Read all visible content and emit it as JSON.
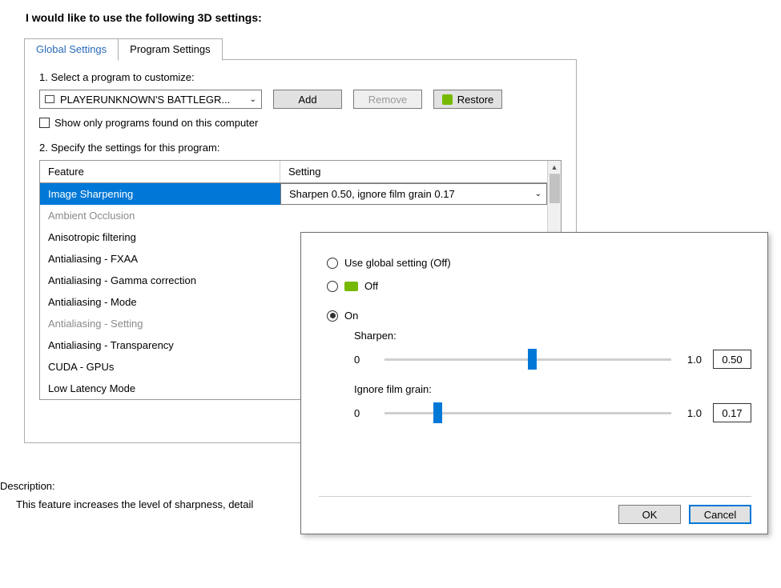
{
  "title": "I would like to use the following 3D settings:",
  "tabs": {
    "global": "Global Settings",
    "program": "Program Settings"
  },
  "step1": "1. Select a program to customize:",
  "selected_program": "PLAYERUNKNOWN'S BATTLEGR...",
  "buttons": {
    "add": "Add",
    "remove": "Remove",
    "restore": "Restore"
  },
  "show_only": "Show only programs found on this computer",
  "step2": "2. Specify the settings for this program:",
  "grid": {
    "feature_header": "Feature",
    "setting_header": "Setting",
    "rows": [
      {
        "feature": "Image Sharpening",
        "setting": "Sharpen 0.50, ignore film grain 0.17",
        "selected": true
      },
      {
        "feature": "Ambient Occlusion",
        "dimmed": true
      },
      {
        "feature": "Anisotropic filtering"
      },
      {
        "feature": "Antialiasing - FXAA"
      },
      {
        "feature": "Antialiasing - Gamma correction"
      },
      {
        "feature": "Antialiasing - Mode"
      },
      {
        "feature": "Antialiasing - Setting",
        "dimmed": true
      },
      {
        "feature": "Antialiasing - Transparency"
      },
      {
        "feature": "CUDA - GPUs"
      },
      {
        "feature": "Low Latency Mode"
      }
    ]
  },
  "description_label": "Description:",
  "description_text": "This feature increases the level of sharpness, detail",
  "popup": {
    "opt_global": "Use global setting (Off)",
    "opt_off": "Off",
    "opt_on": "On",
    "sharpen_label": "Sharpen:",
    "grain_label": "Ignore film grain:",
    "min": "0",
    "max": "1.0",
    "sharpen_value": "0.50",
    "grain_value": "0.17",
    "ok": "OK",
    "cancel": "Cancel"
  }
}
